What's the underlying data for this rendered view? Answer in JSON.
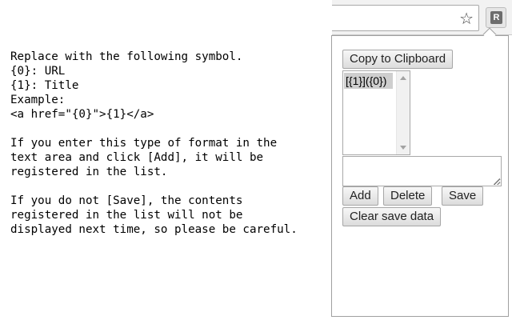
{
  "help": {
    "lines": [
      "Replace with the following symbol.",
      "{0}: URL",
      "{1}: Title",
      "Example:",
      "<a href=\"{0}\">{1}</a>",
      "",
      "If you enter this type of format in the",
      "text area and click [Add], it will be",
      "registered in the list.",
      "",
      "If you do not [Save], the contents",
      "registered in the list will not be",
      "displayed next time, so please be careful."
    ]
  },
  "toolbar": {
    "star_icon": "star-icon",
    "extension_icon": "R"
  },
  "popup": {
    "copy_label": "Copy to Clipboard",
    "list_items": [
      "[{1}]({0})"
    ],
    "textarea_value": "",
    "add_label": "Add",
    "delete_label": "Delete",
    "save_label": "Save",
    "clear_label": "Clear save data"
  }
}
